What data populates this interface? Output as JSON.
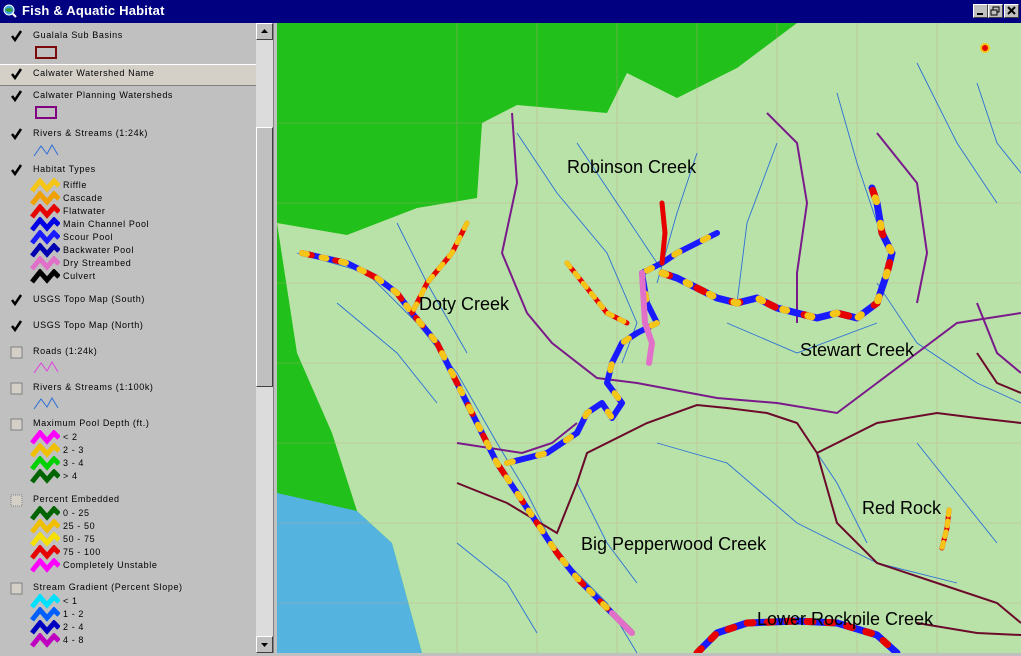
{
  "window": {
    "title": "Fish & Aquatic Habitat",
    "controls": [
      "minimize",
      "restore",
      "close"
    ]
  },
  "toc": {
    "layers": [
      {
        "name": "Gualala Sub Basins",
        "checked": true,
        "legend_symbol": "polygon-dark-red"
      },
      {
        "name": "Calwater Watershed Name",
        "checked": true,
        "selected": true
      },
      {
        "name": "Calwater Planning Watersheds",
        "checked": true,
        "legend_symbol": "polygon-purple"
      },
      {
        "name": "Rivers & Streams (1:24k)",
        "checked": true,
        "legend_symbol": "line-blue"
      },
      {
        "name": "Habitat Types",
        "checked": true,
        "classes": [
          "Riffle",
          "Cascade",
          "Flatwater",
          "Main Channel Pool",
          "Scour Pool",
          "Backwater Pool",
          "Dry Streambed",
          "Culvert"
        ],
        "class_colors": [
          "#f5c518",
          "#f0a000",
          "#e60000",
          "#0000e6",
          "#1a1aff",
          "#0000b0",
          "#e070c8",
          "#000000"
        ]
      },
      {
        "name": "USGS Topo Map (South)",
        "checked": true
      },
      {
        "name": "USGS Topo Map (North)",
        "checked": true
      },
      {
        "name": "Roads (1:24k)",
        "checked": false,
        "legend_symbol": "line-magenta"
      },
      {
        "name": "Rivers & Streams (1:100k)",
        "checked": false,
        "legend_symbol": "line-blue"
      },
      {
        "name": "Maximum Pool Depth (ft.)",
        "checked": false,
        "classes": [
          "< 2",
          "2 - 3",
          "3 - 4",
          "> 4"
        ],
        "class_colors": [
          "#ff00ff",
          "#f0c000",
          "#00d000",
          "#006400"
        ]
      },
      {
        "name": "Percent Embedded",
        "checked": false,
        "classes": [
          "0 - 25",
          "25 - 50",
          "50 - 75",
          "75 - 100",
          "Completely Unstable"
        ],
        "class_colors": [
          "#006400",
          "#f0c000",
          "#f5e000",
          "#e60000",
          "#ff00ff"
        ]
      },
      {
        "name": "Stream Gradient (Percent Slope)",
        "checked": false,
        "classes": [
          "< 1",
          "1 - 2",
          "2 - 4",
          "4 - 8"
        ],
        "class_colors": [
          "#00e0ff",
          "#0060ff",
          "#0000c0",
          "#c000c0"
        ]
      }
    ]
  },
  "map": {
    "labels": [
      "Robinson Creek",
      "Doty Creek",
      "Stewart Creek",
      "Red Rock",
      "Big Pepperwood Creek",
      "Lower Rockpile Creek"
    ],
    "colors": {
      "land": "#b9e2a8",
      "outside": "#22c01a",
      "ocean": "#55b3e0",
      "boundary": "#6b0a2a",
      "planning": "#7a1a8a",
      "stream": "#2a6fd8"
    }
  }
}
